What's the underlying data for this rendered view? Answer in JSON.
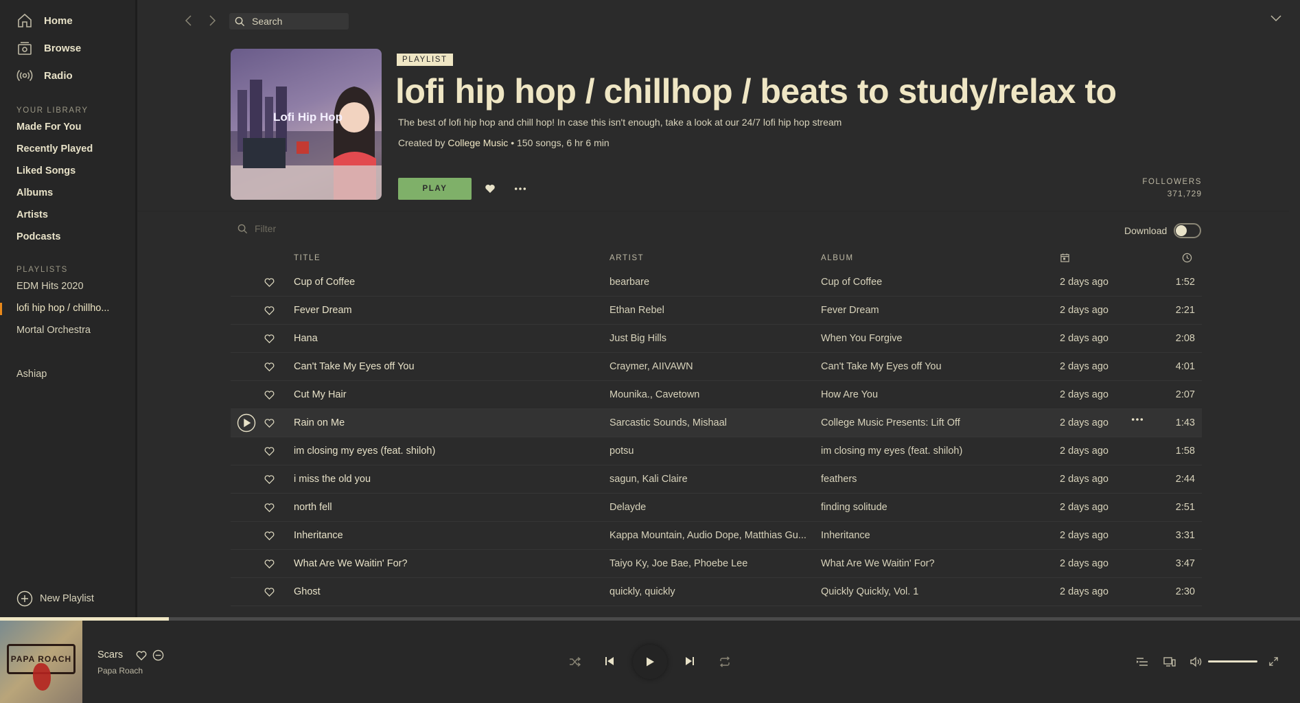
{
  "sidebar": {
    "nav": [
      {
        "label": "Home",
        "icon": "home-icon"
      },
      {
        "label": "Browse",
        "icon": "browse-icon"
      },
      {
        "label": "Radio",
        "icon": "radio-icon"
      }
    ],
    "library_heading": "YOUR LIBRARY",
    "library": [
      "Made For You",
      "Recently Played",
      "Liked Songs",
      "Albums",
      "Artists",
      "Podcasts"
    ],
    "playlists_heading": "PLAYLISTS",
    "playlists": [
      "EDM Hits 2020",
      "lofi hip hop / chillho...",
      "Mortal Orchestra"
    ],
    "active_playlist_index": 1,
    "user": "Ashiap",
    "new_playlist_label": "New Playlist"
  },
  "topbar": {
    "search_placeholder": "Search"
  },
  "header": {
    "badge": "PLAYLIST",
    "title": "lofi hip hop / chillhop / beats to study/relax to",
    "description": "The best of lofi hip hop and chill hop! In case this isn't enough, take a look at our 24/7 lofi hip hop stream",
    "created_by_prefix": "Created by",
    "creator": "College Music",
    "meta_suffix": "• 150 songs, 6 hr 6 min",
    "cover_label": "Lofi Hip Hop",
    "play_label": "PLAY",
    "followers_label": "FOLLOWERS",
    "followers_count": "371,729"
  },
  "filter": {
    "placeholder": "Filter",
    "download_label": "Download",
    "download_enabled": false
  },
  "table": {
    "headers": {
      "title": "TITLE",
      "artist": "ARTIST",
      "album": "ALBUM"
    },
    "rows": [
      {
        "title": "Cup of Coffee",
        "artist": "bearbare",
        "album": "Cup of Coffee",
        "added": "2 days ago",
        "duration": "1:52"
      },
      {
        "title": "Fever Dream",
        "artist": "Ethan Rebel",
        "album": "Fever Dream",
        "added": "2 days ago",
        "duration": "2:21"
      },
      {
        "title": "Hana",
        "artist": "Just Big Hills",
        "album": "When You Forgive",
        "added": "2 days ago",
        "duration": "2:08"
      },
      {
        "title": "Can't Take My Eyes off You",
        "artist": "Craymer, AIIVAWN",
        "album": "Can't Take My Eyes off You",
        "added": "2 days ago",
        "duration": "4:01"
      },
      {
        "title": "Cut My Hair",
        "artist": "Mounika., Cavetown",
        "album": "How Are You",
        "added": "2 days ago",
        "duration": "2:07"
      },
      {
        "title": "Rain on Me",
        "artist": "Sarcastic Sounds, Mishaal",
        "album": "College Music Presents: Lift Off",
        "added": "2 days ago",
        "duration": "1:43"
      },
      {
        "title": "im closing my eyes (feat. shiloh)",
        "artist": "potsu",
        "album": "im closing my eyes (feat. shiloh)",
        "added": "2 days ago",
        "duration": "1:58"
      },
      {
        "title": "i miss the old you",
        "artist": "sagun, Kali Claire",
        "album": "feathers",
        "added": "2 days ago",
        "duration": "2:44"
      },
      {
        "title": "north fell",
        "artist": "Delayde",
        "album": "finding solitude",
        "added": "2 days ago",
        "duration": "2:51"
      },
      {
        "title": "Inheritance",
        "artist": "Kappa Mountain, Audio Dope, Matthias Gu...",
        "album": "Inheritance",
        "added": "2 days ago",
        "duration": "3:31"
      },
      {
        "title": "What Are We Waitin' For?",
        "artist": "Taiyo Ky, Joe Bae, Phoebe Lee",
        "album": "What Are We Waitin' For?",
        "added": "2 days ago",
        "duration": "3:47"
      },
      {
        "title": "Ghost",
        "artist": "quickly, quickly",
        "album": "Quickly Quickly, Vol. 1",
        "added": "2 days ago",
        "duration": "2:30"
      }
    ],
    "hovered_row_index": 5
  },
  "player": {
    "track": "Scars",
    "artist": "Papa Roach",
    "album_art_text": "PAPA ROACH",
    "progress": 0.13,
    "volume": 1.0
  },
  "colors": {
    "accent_green": "#7fb069",
    "text_cream": "#efe6c4",
    "active_marker": "#e8881a",
    "background": "#2b2b2b"
  }
}
